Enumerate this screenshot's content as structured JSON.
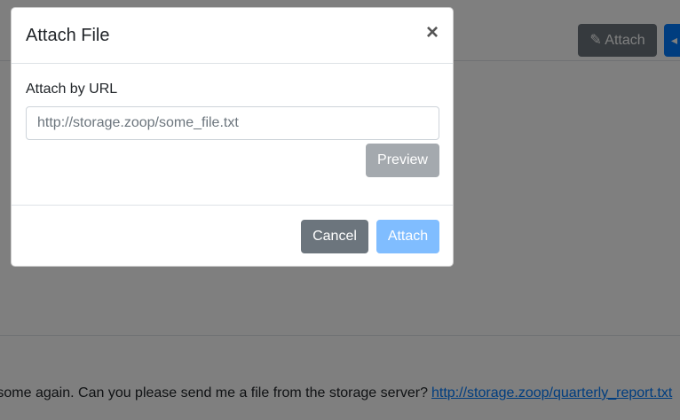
{
  "background": {
    "attach_button": {
      "icon": "paperclip-icon",
      "icon_glyph": "✎",
      "label": "Attach"
    },
    "send_button": {
      "icon": "send-icon",
      "icon_glyph": "◂"
    },
    "message": {
      "text": "some again. Can you please send me a file from the storage server?",
      "link": "http://storage.zoop/quarterly_report.txt"
    }
  },
  "modal": {
    "title": "Attach File",
    "close_glyph": "×",
    "url_label": "Attach by URL",
    "url_input": {
      "value": "",
      "placeholder": "http://storage.zoop/some_file.txt"
    },
    "preview_label": "Preview",
    "cancel_label": "Cancel",
    "attach_label": "Attach"
  },
  "colors": {
    "primary": "#007bff",
    "primary_disabled": "#80bdff",
    "secondary": "#6c757d",
    "secondary_disabled": "#a4a9ae",
    "link": "#007bff"
  }
}
